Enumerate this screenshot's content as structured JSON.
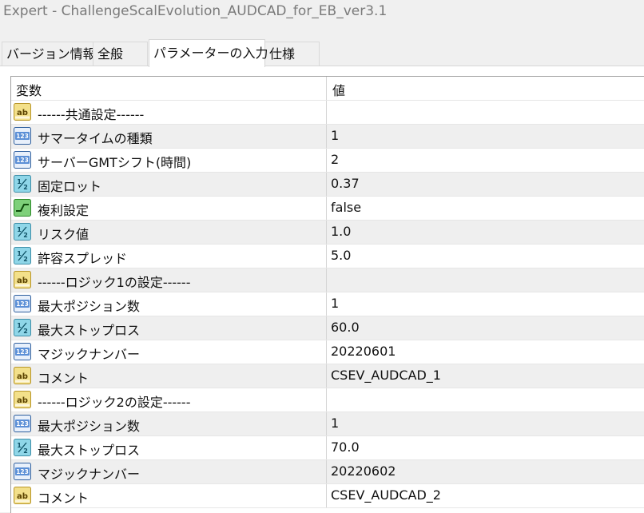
{
  "window": {
    "title": "Expert - ChallengeScalEvolution_AUDCAD_for_EB_ver3.1"
  },
  "tabs": [
    {
      "label": "バージョン情報"
    },
    {
      "label": "全般"
    },
    {
      "label": "パラメーターの入力"
    },
    {
      "label": "仕様"
    }
  ],
  "table": {
    "headers": {
      "variable": "変数",
      "value": "値"
    },
    "rows": [
      {
        "type": "string",
        "icon": "string-ab-icon",
        "name": "------共通設定------",
        "value": ""
      },
      {
        "type": "int",
        "icon": "integer-123-icon",
        "name": "サマータイムの種類",
        "value": "1"
      },
      {
        "type": "int",
        "icon": "integer-123-icon",
        "name": "サーバーGMTシフト(時間)",
        "value": "2"
      },
      {
        "type": "double",
        "icon": "double-half-icon",
        "name": "固定ロット",
        "value": "0.37"
      },
      {
        "type": "bool",
        "icon": "boolean-toggle-icon",
        "name": "複利設定",
        "value": "false"
      },
      {
        "type": "double",
        "icon": "double-half-icon",
        "name": "リスク値",
        "value": "1.0"
      },
      {
        "type": "double",
        "icon": "double-half-icon",
        "name": "許容スプレッド",
        "value": "5.0"
      },
      {
        "type": "string",
        "icon": "string-ab-icon",
        "name": "------ロジック1の設定------",
        "value": ""
      },
      {
        "type": "int",
        "icon": "integer-123-icon",
        "name": "最大ポジション数",
        "value": "1"
      },
      {
        "type": "double",
        "icon": "double-half-icon",
        "name": "最大ストップロス",
        "value": "60.0"
      },
      {
        "type": "int",
        "icon": "integer-123-icon",
        "name": "マジックナンバー",
        "value": "20220601"
      },
      {
        "type": "string",
        "icon": "string-ab-icon",
        "name": "コメント",
        "value": "CSEV_AUDCAD_1"
      },
      {
        "type": "string",
        "icon": "string-ab-icon",
        "name": "------ロジック2の設定------",
        "value": ""
      },
      {
        "type": "int",
        "icon": "integer-123-icon",
        "name": "最大ポジション数",
        "value": "1"
      },
      {
        "type": "double",
        "icon": "double-half-icon",
        "name": "最大ストップロス",
        "value": "70.0"
      },
      {
        "type": "int",
        "icon": "integer-123-icon",
        "name": "マジックナンバー",
        "value": "20220602"
      },
      {
        "type": "string",
        "icon": "string-ab-icon",
        "name": "コメント",
        "value": "CSEV_AUDCAD_2"
      }
    ]
  },
  "colors": {
    "string_icon_bg": "#f3e08a",
    "string_icon_border": "#b8962a",
    "int_icon_bg": "#5b8fd6",
    "int_icon_border": "#2f5f9e",
    "double_icon_bg": "#8fd6e8",
    "double_icon_border": "#3f8fa8",
    "bool_icon_bg": "#7ed07a",
    "bool_icon_border": "#2e8a2a",
    "row_alt": "#efefef"
  }
}
